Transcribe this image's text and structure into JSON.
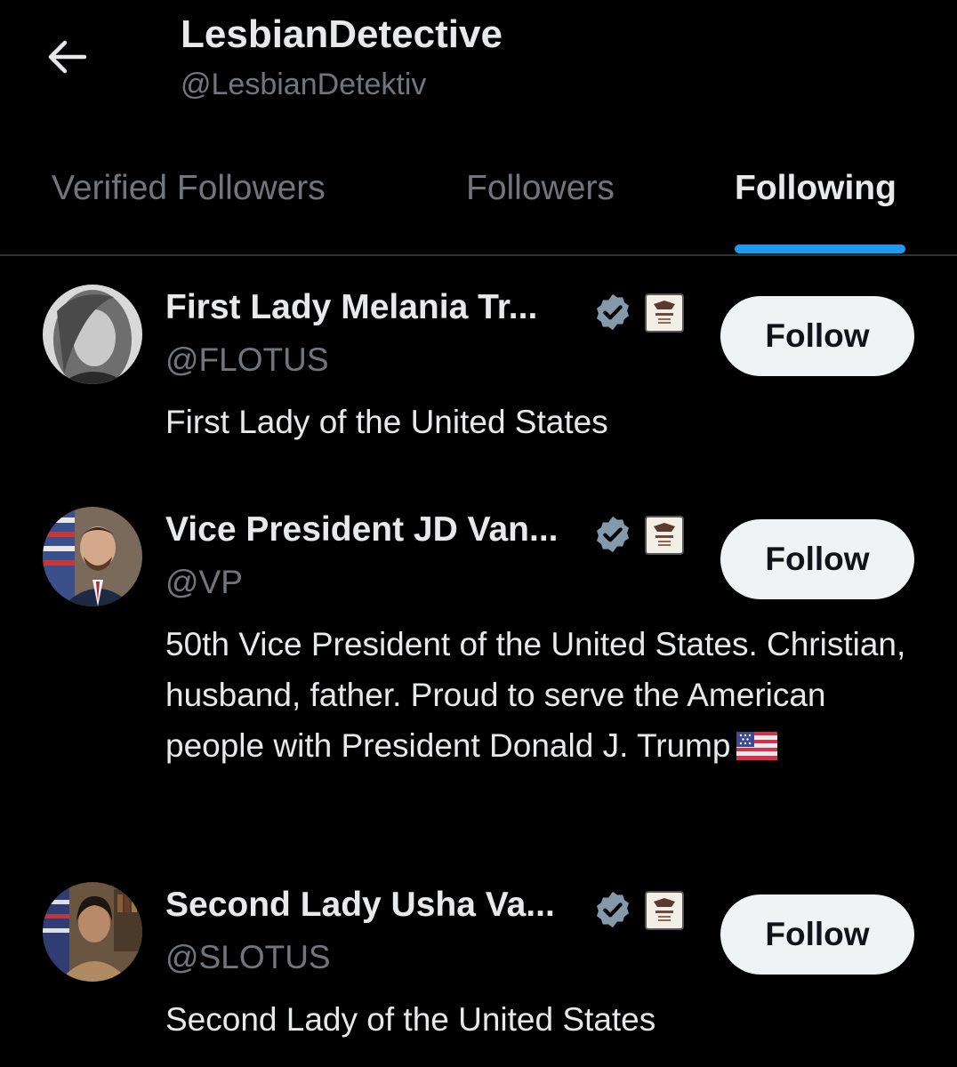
{
  "header": {
    "display_name": "LesbianDetective",
    "handle": "@LesbianDetektiv",
    "back_icon": "arrow-left-icon"
  },
  "tabs": [
    {
      "label": "Verified Followers",
      "active": false
    },
    {
      "label": "Followers",
      "active": false
    },
    {
      "label": "Following",
      "active": true
    }
  ],
  "colors": {
    "background": "#000000",
    "primary_text": "#e7e9ea",
    "secondary_text": "#71767b",
    "accent": "#1d9bf0",
    "verified_badge": "#829aab",
    "follow_button_bg": "#eff3f4",
    "follow_button_text": "#0f1419"
  },
  "users": [
    {
      "name": "First Lady Melania Tr...",
      "handle": "@FLOTUS",
      "bio": "First Lady of the United States",
      "badges": [
        "verified-government-icon",
        "white-house-affiliate-icon"
      ],
      "follow_label": "Follow"
    },
    {
      "name": "Vice President JD Van...",
      "handle": "@VP",
      "bio": "50th Vice President of the United States. Christian, husband, father. Proud to serve the American people with President Donald J. Trump",
      "bio_trailing_emoji": "us-flag-icon",
      "badges": [
        "verified-government-icon",
        "white-house-affiliate-icon"
      ],
      "follow_label": "Follow"
    },
    {
      "name": "Second Lady Usha Va...",
      "handle": "@SLOTUS",
      "bio": "Second Lady of the United States",
      "badges": [
        "verified-government-icon",
        "white-house-affiliate-icon"
      ],
      "follow_label": "Follow"
    }
  ]
}
